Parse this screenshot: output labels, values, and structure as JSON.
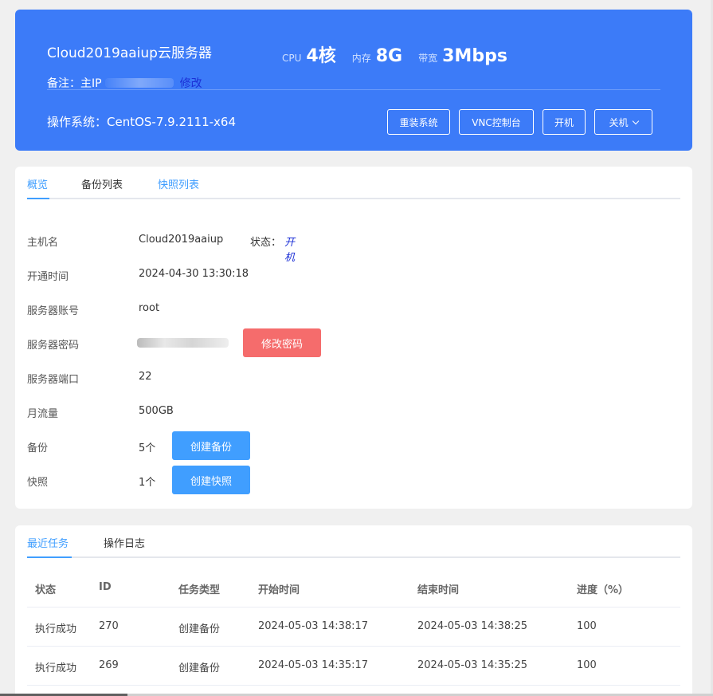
{
  "header": {
    "server_name": "Cloud2019aaiup云服务器",
    "specs": [
      {
        "label": "CPU",
        "value": "4核"
      },
      {
        "label": "内存",
        "value": "8G"
      },
      {
        "label": "带宽",
        "value": "3Mbps"
      }
    ],
    "remark_label": "备注：主IP",
    "edit_label": "修改",
    "os_label": "操作系统：CentOS-7.9.2111-x64",
    "buttons": {
      "reinstall": "重装系统",
      "vnc": "VNC控制台",
      "power_on": "开机",
      "power_off": "关机"
    }
  },
  "overview": {
    "tabs": [
      "概览",
      "备份列表",
      "快照列表"
    ],
    "rows": {
      "hostname": {
        "label": "主机名",
        "value": "Cloud2019aaiup"
      },
      "status": {
        "label": "状态：",
        "value": "开机"
      },
      "open_time": {
        "label": "开通时间",
        "value": "2024-04-30 13:30:18"
      },
      "account": {
        "label": "服务器账号",
        "value": "root"
      },
      "password": {
        "label": "服务器密码"
      },
      "port": {
        "label": "服务器端口",
        "value": "22"
      },
      "traffic": {
        "label": "月流量",
        "value": "500GB"
      },
      "backup": {
        "label": "备份",
        "value": "5个"
      },
      "snapshot": {
        "label": "快照",
        "value": "1个"
      }
    },
    "buttons": {
      "change_password": "修改密码",
      "create_backup": "创建备份",
      "create_snapshot": "创建快照"
    }
  },
  "tasks": {
    "tabs": [
      "最近任务",
      "操作日志"
    ],
    "columns": [
      "状态",
      "ID",
      "任务类型",
      "开始时间",
      "结束时间",
      "进度（%）"
    ],
    "rows": [
      [
        "执行成功",
        "270",
        "创建备份",
        "2024-05-03 14:38:17",
        "2024-05-03 14:38:25",
        "100"
      ],
      [
        "执行成功",
        "269",
        "创建备份",
        "2024-05-03 14:35:17",
        "2024-05-03 14:35:25",
        "100"
      ]
    ]
  }
}
